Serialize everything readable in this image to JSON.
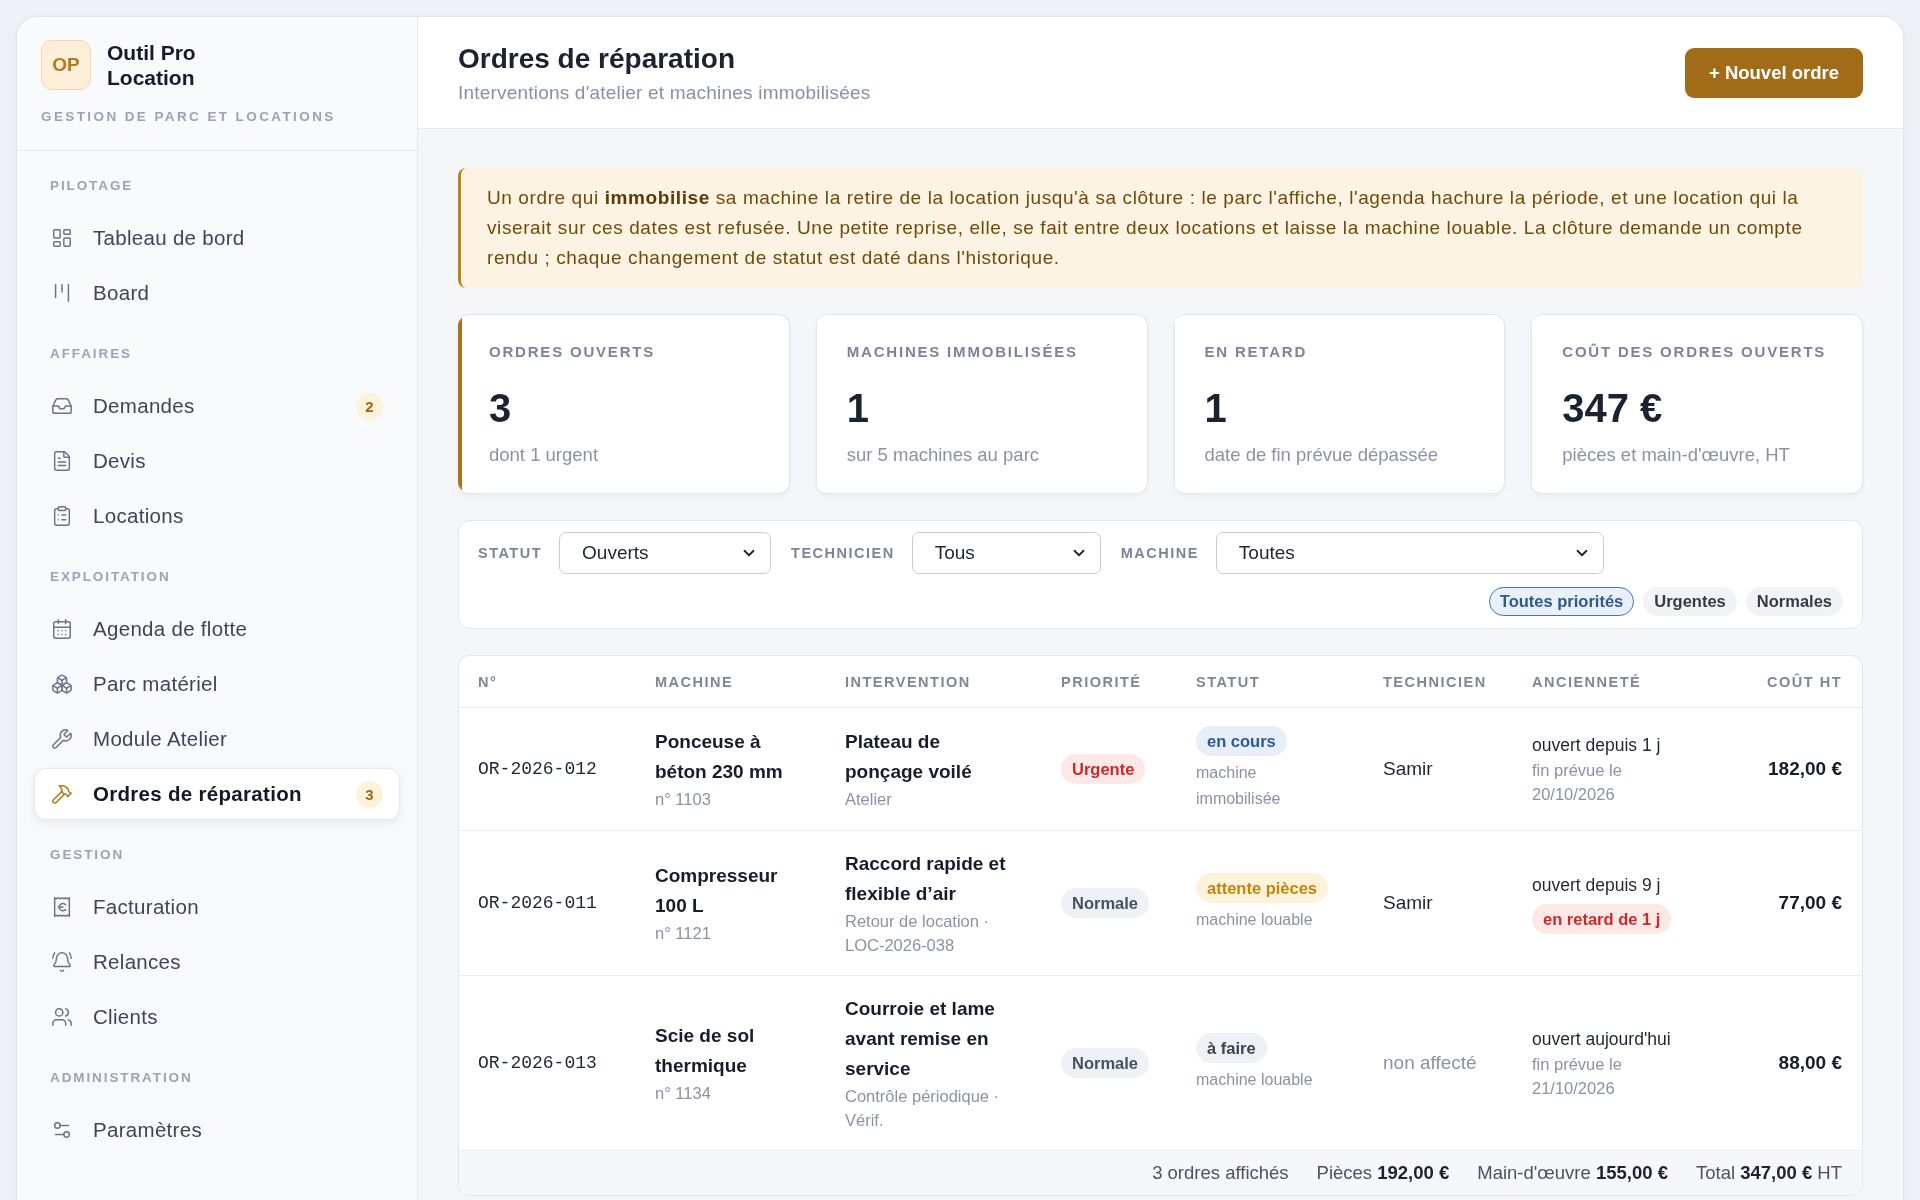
{
  "sidebar": {
    "logo": "OP",
    "brand": "Outil Pro Location",
    "tagline": "GESTION DE PARC ET LOCATIONS",
    "sections": [
      {
        "label": "PILOTAGE",
        "items": [
          {
            "label": "Tableau de bord",
            "selected": false
          },
          {
            "label": "Board",
            "selected": false
          }
        ]
      },
      {
        "label": "AFFAIRES",
        "items": [
          {
            "label": "Demandes",
            "selected": false,
            "badge": "2"
          },
          {
            "label": "Devis",
            "selected": false
          },
          {
            "label": "Locations",
            "selected": false
          }
        ]
      },
      {
        "label": "EXPLOITATION",
        "items": [
          {
            "label": "Agenda de flotte",
            "selected": false
          },
          {
            "label": "Parc matériel",
            "selected": false
          },
          {
            "label": "Module Atelier",
            "selected": false
          },
          {
            "label": "Ordres de réparation",
            "selected": true,
            "badge": "3"
          }
        ]
      },
      {
        "label": "GESTION",
        "items": [
          {
            "label": "Facturation",
            "selected": false
          },
          {
            "label": "Relances",
            "selected": false
          },
          {
            "label": "Clients",
            "selected": false
          }
        ]
      },
      {
        "label": "ADMINISTRATION",
        "items": [
          {
            "label": "Paramètres",
            "selected": false
          }
        ]
      }
    ]
  },
  "header": {
    "title": "Ordres de réparation",
    "subtitle": "Interventions d'atelier et machines immobilisées",
    "action": "+ Nouvel ordre"
  },
  "notice": "Un ordre qui **immobilise** sa machine la retire de la location jusqu'à sa clôture : le parc l'affiche, l'agenda hachure la période, et une location qui la viserait sur ces dates est refusée. Une petite reprise, elle, se fait entre deux locations et laisse la machine louable. La clôture demande un compte rendu ; chaque changement de statut est daté dans l'historique.",
  "stats": [
    {
      "label": "ORDRES OUVERTS",
      "value": "3",
      "note": "dont 1 urgent",
      "highlighted": true
    },
    {
      "label": "MACHINES IMMOBILISÉES",
      "value": "1",
      "note": "sur 5 machines au parc",
      "highlighted": false
    },
    {
      "label": "EN RETARD",
      "value": "1",
      "note": "date de fin prévue dépassée",
      "highlighted": false
    },
    {
      "label": "COÛT DES ORDRES OUVERTS",
      "value": "347 €",
      "note": "pièces et main-d'œuvre, HT",
      "highlighted": false
    }
  ],
  "filters": {
    "selects": [
      {
        "label": "STATUT",
        "value": "Ouverts"
      },
      {
        "label": "TECHNICIEN",
        "value": "Tous"
      },
      {
        "label": "MACHINE",
        "value": "Toutes"
      }
    ],
    "priorities": [
      {
        "label": "Toutes priorités",
        "selected": true
      },
      {
        "label": "Urgentes",
        "selected": false
      },
      {
        "label": "Normales",
        "selected": false
      }
    ]
  },
  "table": {
    "columns": [
      "N°",
      "MACHINE",
      "INTERVENTION",
      "PRIORITÉ",
      "STATUT",
      "TECHNICIEN",
      "ANCIENNETÉ",
      "COÛT HT"
    ],
    "rows": [
      {
        "number": "OR-2026-012",
        "machine": {
          "name": "Ponceuse à béton 230 mm",
          "ref": "n° 1103"
        },
        "intervention": {
          "title": "Plateau de ponçage voilé",
          "detail": "Atelier"
        },
        "priority": {
          "label": "Urgente",
          "kind": "urgent"
        },
        "status": {
          "label": "en cours",
          "kind": "in_progress",
          "note": "machine immobilisée"
        },
        "technician": {
          "name": "Samir",
          "assigned": true
        },
        "age": {
          "opened": "ouvert depuis 1 j",
          "note": "fin prévue le 20/10/2026",
          "kind": "due"
        },
        "cost": "182,00 €"
      },
      {
        "number": "OR-2026-011",
        "machine": {
          "name": "Compresseur 100 L",
          "ref": "n° 1121"
        },
        "intervention": {
          "title": "Raccord rapide et flexible d’air",
          "detail": "Retour de location · LOC-2026-038"
        },
        "priority": {
          "label": "Normale",
          "kind": "normal"
        },
        "status": {
          "label": "attente pièces",
          "kind": "waiting_parts",
          "note": "machine louable"
        },
        "technician": {
          "name": "Samir",
          "assigned": true
        },
        "age": {
          "opened": "ouvert depuis 9 j",
          "note": "en retard de 1 j",
          "kind": "late"
        },
        "cost": "77,00 €"
      },
      {
        "number": "OR-2026-013",
        "machine": {
          "name": "Scie de sol thermique",
          "ref": "n° 1134"
        },
        "intervention": {
          "title": "Courroie et lame avant remise en service",
          "detail": "Contrôle périodique · Vérif."
        },
        "priority": {
          "label": "Normale",
          "kind": "normal"
        },
        "status": {
          "label": "à faire",
          "kind": "todo",
          "note": "machine louable"
        },
        "technician": {
          "name": "non affecté",
          "assigned": false
        },
        "age": {
          "opened": "ouvert aujourd'hui",
          "note": "fin prévue le 21/10/2026",
          "kind": "due"
        },
        "cost": "88,00 €"
      }
    ],
    "footer": [
      "3 ordres affichés",
      "Pièces **192,00 €**",
      "Main-d'œuvre **155,00 €**",
      "Total **347,00 €** HT"
    ]
  }
}
